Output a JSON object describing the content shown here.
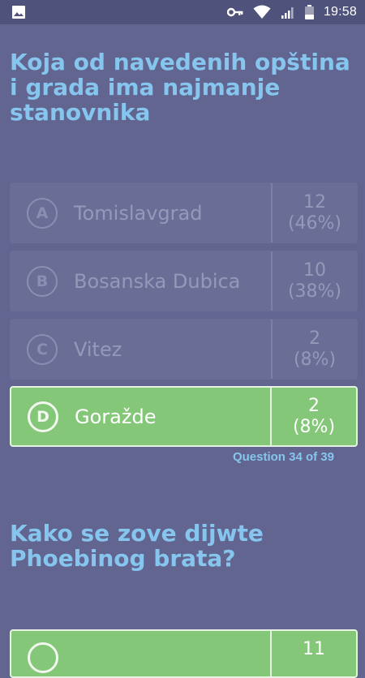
{
  "status_bar": {
    "time": "19:58",
    "icons": [
      "image-icon",
      "vpn-key-icon",
      "wifi-icon",
      "signal-icon",
      "battery-icon"
    ]
  },
  "question1": {
    "title": "Koja od navedenih opština i grada ima najmanje stanovnika",
    "answers": [
      {
        "letter": "A",
        "text": "Tomislavgrad",
        "count": "12",
        "percent": "(46%)",
        "state": "dim"
      },
      {
        "letter": "B",
        "text": "Bosanska Dubica",
        "count": "10",
        "percent": "(38%)",
        "state": "dim"
      },
      {
        "letter": "C",
        "text": "Vitez",
        "count": "2",
        "percent": "(8%)",
        "state": "dim"
      },
      {
        "letter": "D",
        "text": "Goražde",
        "count": "2",
        "percent": "(8%)",
        "state": "correct"
      }
    ],
    "counter": "Question 34 of 39"
  },
  "question2": {
    "title": "Kako se zove dijwte Phoebinog brata?",
    "first_answer_count": "11"
  },
  "colors": {
    "background": "#61658f",
    "status_bar": "#4f527a",
    "title": "#86c6ee",
    "correct": "#84c779",
    "dim_card": "#6a6e97"
  }
}
